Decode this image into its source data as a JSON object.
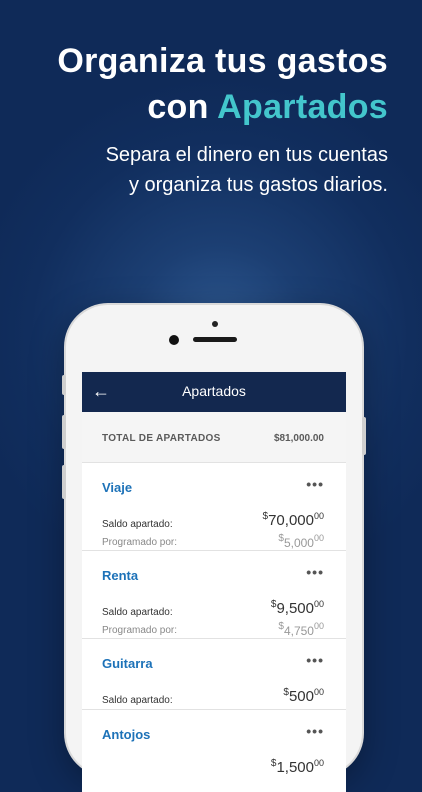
{
  "headline": {
    "line1": "Organiza tus gastos",
    "line2_prefix": "con ",
    "line2_accent": "Apartados"
  },
  "subtitle": {
    "line1": "Separa el dinero en tus cuentas",
    "line2": "y organiza tus gastos diarios."
  },
  "app": {
    "nav_back_icon": "←",
    "title": "Apartados",
    "total": {
      "label": "TOTAL DE APARTADOS",
      "value": "$81,000.00"
    },
    "more_icon": "•••",
    "items": [
      {
        "name": "Viaje",
        "saved_label": "Saldo apartado:",
        "saved_currency": "$",
        "saved_int": "70,000",
        "saved_cents": "00",
        "scheduled_label": "Programado por:",
        "scheduled_currency": "$",
        "scheduled_int": "5,000",
        "scheduled_cents": "00"
      },
      {
        "name": "Renta",
        "saved_label": "Saldo apartado:",
        "saved_currency": "$",
        "saved_int": "9,500",
        "saved_cents": "00",
        "scheduled_label": "Programado por:",
        "scheduled_currency": "$",
        "scheduled_int": "4,750",
        "scheduled_cents": "00"
      },
      {
        "name": "Guitarra",
        "saved_label": "Saldo apartado:",
        "saved_currency": "$",
        "saved_int": "500",
        "saved_cents": "00"
      },
      {
        "name": "Antojos",
        "saved_currency": "$",
        "saved_int": "1,500",
        "saved_cents": "00"
      }
    ]
  },
  "colors": {
    "accent": "#43c6cc",
    "navbar": "#13284f",
    "link": "#1d72b8"
  }
}
